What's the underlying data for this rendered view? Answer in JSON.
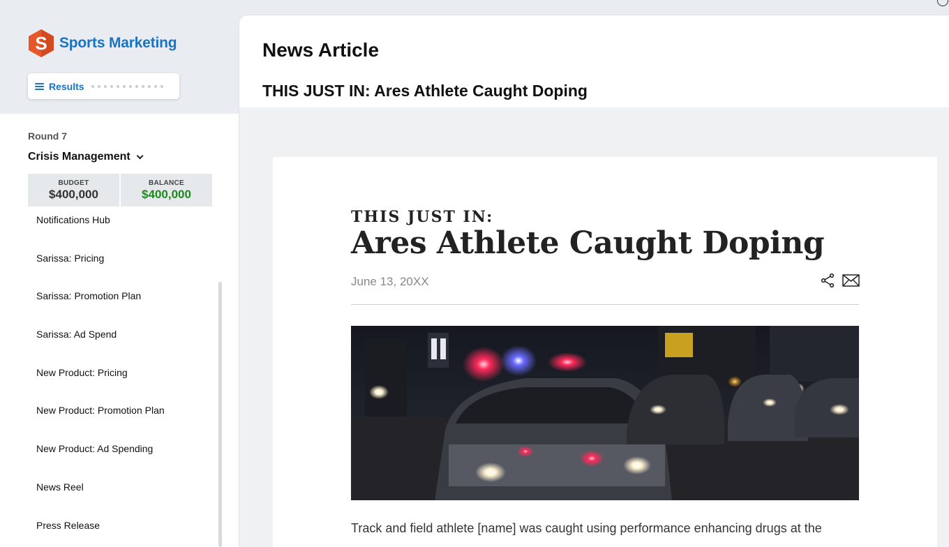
{
  "app": {
    "brand": "Sports Marketing",
    "results_label": "Results"
  },
  "sidebar": {
    "round_label": "Round 7",
    "phase": "Crisis Management",
    "budget": {
      "label": "BUDGET",
      "value": "$400,000"
    },
    "balance": {
      "label": "BALANCE",
      "value": "$400,000",
      "color": "#1e8a1e"
    },
    "items": [
      {
        "label": "Notifications Hub"
      },
      {
        "label": "Sarissa: Pricing"
      },
      {
        "label": "Sarissa: Promotion Plan"
      },
      {
        "label": "Sarissa: Ad Spend"
      },
      {
        "label": "New Product: Pricing"
      },
      {
        "label": "New Product: Promotion Plan"
      },
      {
        "label": "New Product: Ad Spending"
      },
      {
        "label": "News Reel"
      },
      {
        "label": "Press Release"
      }
    ]
  },
  "main": {
    "title": "News Article",
    "subtitle": "THIS JUST IN: Ares Athlete Caught Doping"
  },
  "article": {
    "kicker": "THIS JUST IN:",
    "headline": "Ares Athlete Caught Doping",
    "date": "June 13, 20XX",
    "share_icon": "share-icon",
    "mail_icon": "mail-icon",
    "image_subject": "police car with flashing lights at night",
    "body": "Track and field athlete [name] was caught using performance enhancing drugs at the"
  },
  "colors": {
    "brand_blue": "#1a73c2",
    "logo_orange": "#e8572a"
  }
}
